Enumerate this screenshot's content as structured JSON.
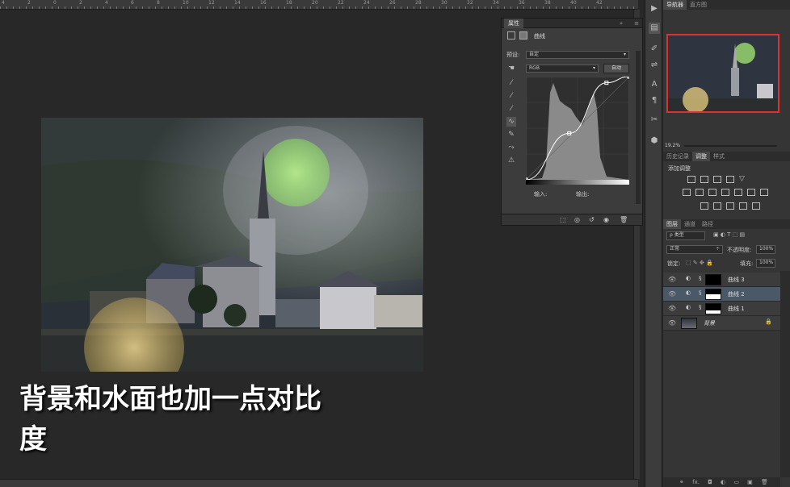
{
  "ruler": {
    "labels": [
      "4",
      "2",
      "0",
      "2",
      "4",
      "6",
      "8",
      "10",
      "12",
      "14",
      "16",
      "18",
      "20",
      "22",
      "24",
      "26",
      "28",
      "30",
      "32",
      "34",
      "36",
      "38",
      "40",
      "42"
    ]
  },
  "caption": {
    "line1": "背景和水面也加一点对比",
    "line2": "度"
  },
  "properties": {
    "tab": "属性",
    "adjustment_name": "曲线",
    "preset_label": "预设:",
    "preset_value": "自定",
    "channel_value": "RGB",
    "auto_button": "自动",
    "input_label": "输入:",
    "output_label": "输出:"
  },
  "curve_points": [
    [
      0,
      0
    ],
    [
      0.42,
      0.45
    ],
    [
      0.78,
      0.94
    ],
    [
      1,
      1
    ]
  ],
  "navigator": {
    "tabs": [
      "导航器",
      "直方图"
    ],
    "zoom": "19.2%"
  },
  "adjustments": {
    "tabs": [
      "历史记录",
      "调整",
      "样式"
    ],
    "title": "添加调整"
  },
  "layers": {
    "tabs": [
      "图层",
      "通道",
      "路径"
    ],
    "kind_label": "ρ 类型",
    "blend_mode": "正常",
    "opacity_label": "不透明度:",
    "opacity_value": "100%",
    "lock_label": "锁定:",
    "fill_label": "填充:",
    "fill_value": "100%",
    "items": [
      {
        "name": "曲线 3",
        "selected": false
      },
      {
        "name": "曲线 2",
        "selected": true
      },
      {
        "name": "曲线 1",
        "selected": false
      },
      {
        "name": "背景",
        "selected": false
      }
    ]
  },
  "colors": {
    "accent": "#4a5868",
    "navigator_frame": "#e03030"
  }
}
